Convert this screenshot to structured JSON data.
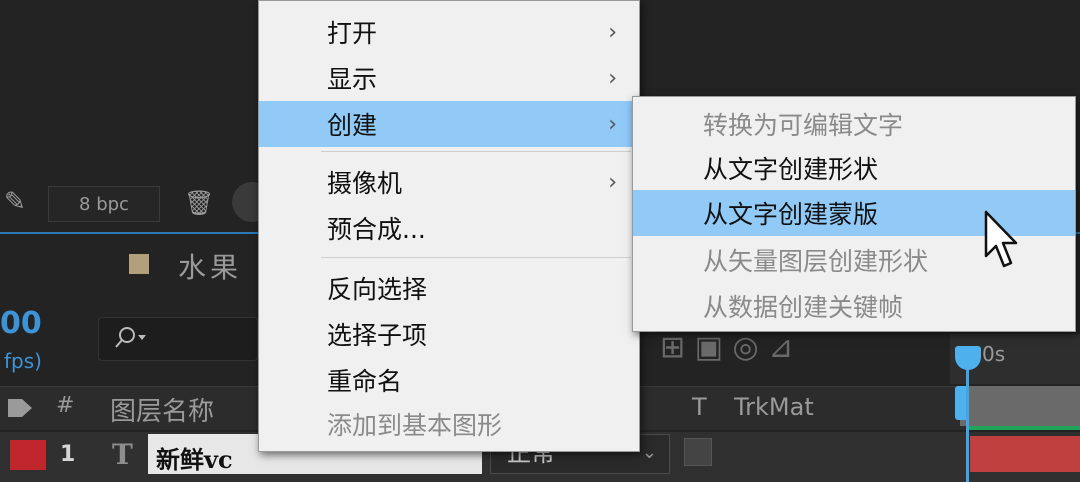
{
  "project_panel": {
    "bit_depth": "8 bpc"
  },
  "composition": {
    "name": "水果",
    "time_display": "00",
    "fps_label": "fps)",
    "swatch_color": "#b29f7b"
  },
  "timeline": {
    "headers": {
      "hash": "#",
      "layer_name": "图层名称",
      "trkmat_t": "T",
      "trkmat": "TrkMat"
    },
    "ruler_label": "0s",
    "layers": [
      {
        "number": "1",
        "type_glyph": "T",
        "name": "新鲜vc",
        "mode": "正常",
        "label_color": "#c0272d"
      }
    ]
  },
  "context_menu": {
    "items": [
      {
        "label": "打开",
        "submenu": true
      },
      {
        "label": "显示",
        "submenu": true
      },
      {
        "label": "创建",
        "submenu": true,
        "highlighted": true
      },
      {
        "label": "摄像机",
        "submenu": true
      },
      {
        "label": "预合成...",
        "submenu": false
      },
      {
        "label": "反向选择",
        "submenu": false
      },
      {
        "label": "选择子项",
        "submenu": false
      },
      {
        "label": "重命名",
        "submenu": false
      },
      {
        "label": "添加到基本图形",
        "submenu": false,
        "disabled": true
      }
    ]
  },
  "create_submenu": {
    "items": [
      {
        "label": "转换为可编辑文字",
        "disabled": true
      },
      {
        "label": "从文字创建形状"
      },
      {
        "label": "从文字创建蒙版",
        "highlighted": true
      },
      {
        "label": "从矢量图层创建形状",
        "disabled": true
      },
      {
        "label": "从数据创建关键帧",
        "disabled": true
      }
    ]
  },
  "colors": {
    "menu_highlight": "#91c9f7",
    "accent_blue": "#3e92d6",
    "playhead": "#3ea6e8"
  },
  "icons": {
    "submenu_arrow": "chevron-right-icon",
    "cursor": "mouse-pointer-icon",
    "search": "search-icon",
    "trash": "trash-icon"
  }
}
